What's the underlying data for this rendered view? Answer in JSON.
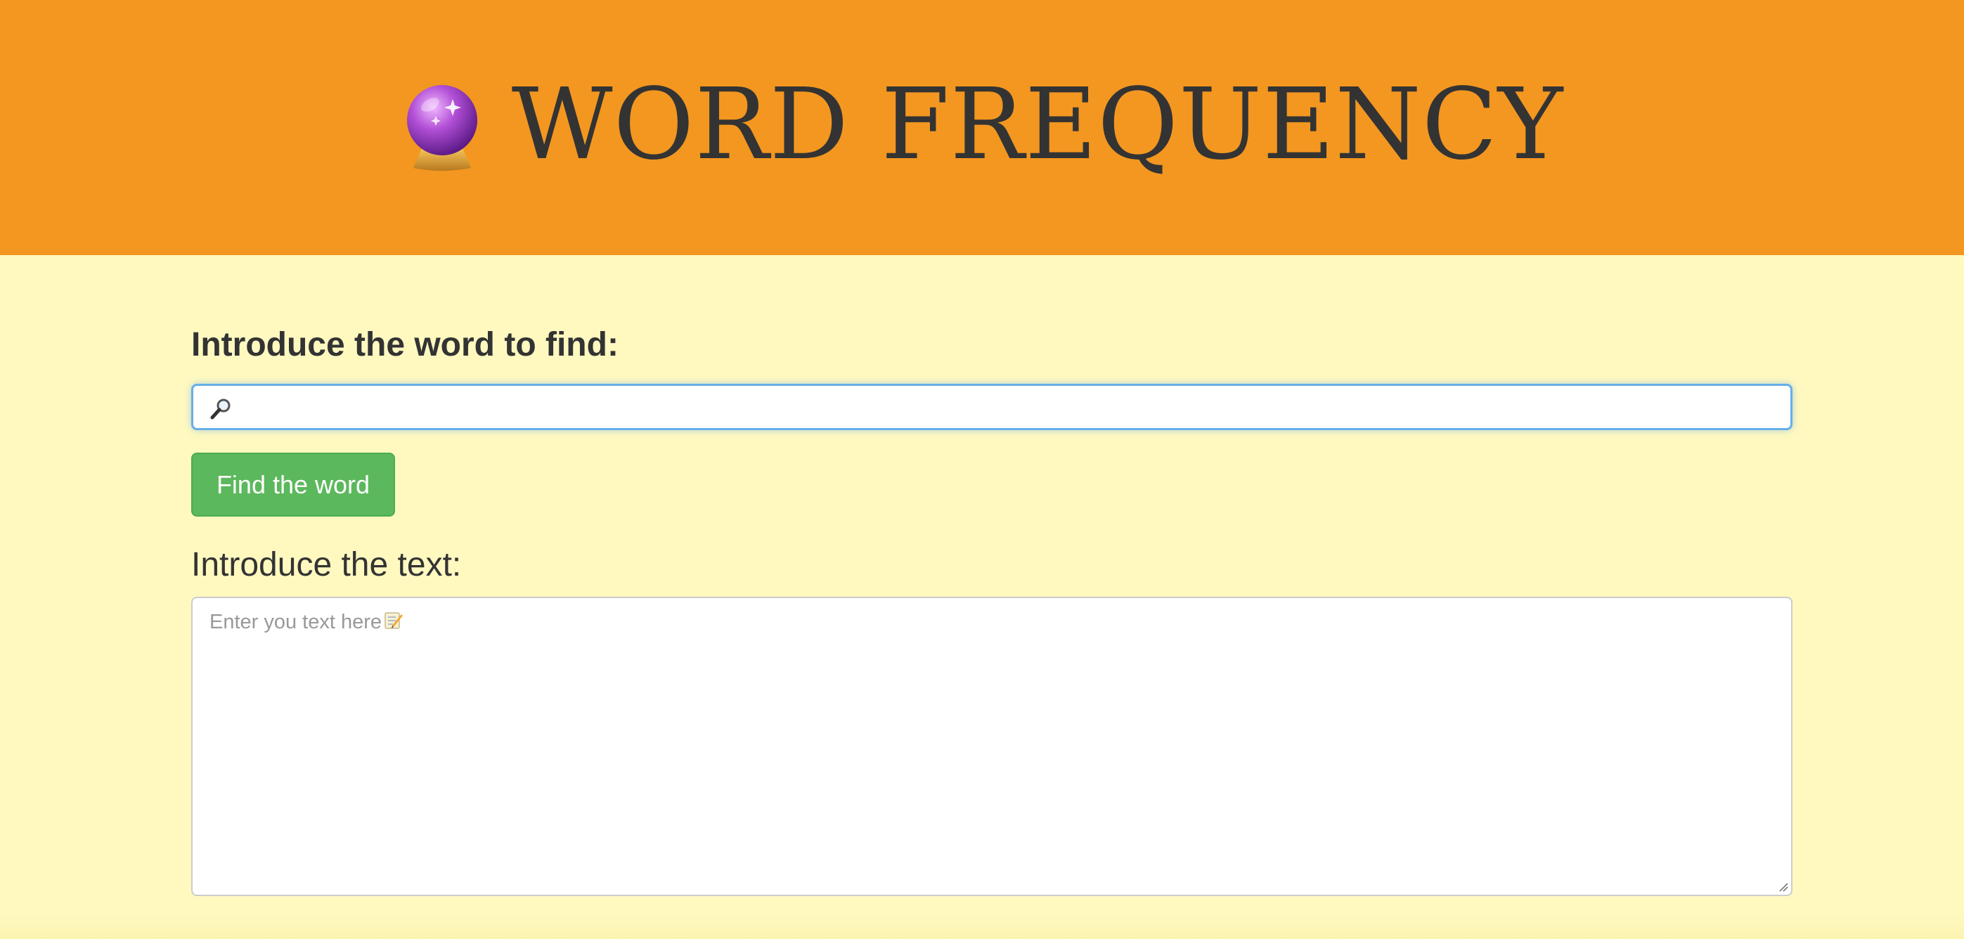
{
  "header": {
    "title": "WORD FREQUENCY",
    "title_icon": "crystal-ball-icon",
    "background_color": "#f39720"
  },
  "search": {
    "label": "Introduce the word to find:",
    "value": "",
    "icon": "magnifying-glass-icon"
  },
  "find_button": {
    "label": "Find the word",
    "color": "#5cb85c"
  },
  "text": {
    "label": "Introduce the text:",
    "placeholder": "Enter you text here",
    "placeholder_icon": "memo-icon"
  },
  "page": {
    "background_color": "#fff9c0"
  }
}
